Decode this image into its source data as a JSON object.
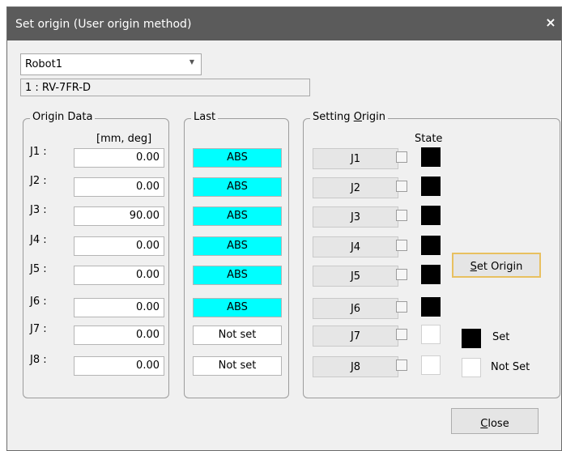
{
  "dialog": {
    "title": "Set origin (User origin method)",
    "close_glyph": "×"
  },
  "robot": {
    "selected": "Robot1",
    "model": "1 : RV-7FR-D"
  },
  "origin_data": {
    "group_label": "Origin Data",
    "units": "[mm, deg]",
    "rows": [
      {
        "joint": "J1 :",
        "value": "0.00"
      },
      {
        "joint": "J2 :",
        "value": "0.00"
      },
      {
        "joint": "J3 :",
        "value": "90.00"
      },
      {
        "joint": "J4 :",
        "value": "0.00"
      },
      {
        "joint": "J5 :",
        "value": "0.00"
      },
      {
        "joint": "J6 :",
        "value": "0.00"
      },
      {
        "joint": "J7 :",
        "value": "0.00"
      },
      {
        "joint": "J8 :",
        "value": "0.00"
      }
    ]
  },
  "last": {
    "group_label": "Last",
    "values": [
      "ABS",
      "ABS",
      "ABS",
      "ABS",
      "ABS",
      "ABS",
      "Not set",
      "Not set"
    ]
  },
  "setting_origin": {
    "group_label_pre": "Setting ",
    "group_label_u": "O",
    "group_label_post": "rigin",
    "state_header": "State",
    "joints": [
      {
        "label": "J1",
        "checked": false,
        "state": "set"
      },
      {
        "label": "J2",
        "checked": false,
        "state": "set"
      },
      {
        "label": "J3",
        "checked": false,
        "state": "set"
      },
      {
        "label": "J4",
        "checked": false,
        "state": "set"
      },
      {
        "label": "J5",
        "checked": false,
        "state": "set"
      },
      {
        "label": "J6",
        "checked": false,
        "state": "set"
      },
      {
        "label": "J7",
        "checked": false,
        "state": "not-set"
      },
      {
        "label": "J8",
        "checked": false,
        "state": "not-set"
      }
    ],
    "legend_set": "Set",
    "legend_not_set": "Not Set"
  },
  "buttons": {
    "set_origin_u": "S",
    "set_origin_rest": "et Origin",
    "close_u": "C",
    "close_rest": "lose"
  },
  "colors": {
    "abs_fill": "#00ffff",
    "state_set": "#000000",
    "state_not_set": "#ffffff",
    "titlebar": "#5b5b5b"
  }
}
